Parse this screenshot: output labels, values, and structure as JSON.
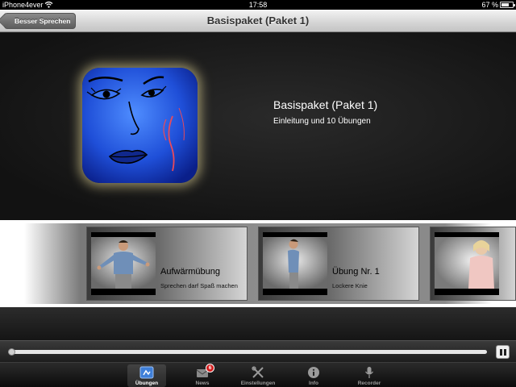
{
  "status_bar": {
    "carrier": "iPhone4ever",
    "time": "17:58",
    "battery_percent": "67 %",
    "battery_level": 0.67
  },
  "nav_bar": {
    "back_label": "Besser Sprechen",
    "title": "Basispaket (Paket 1)"
  },
  "package": {
    "title": "Basispaket (Paket 1)",
    "subtitle": "Einleitung und 10 Übungen",
    "icon_name": "face-sketch-app-icon"
  },
  "exercises": [
    {
      "title": "Aufwärmübung",
      "subtitle": "Sprechen darf Spaß machen",
      "thumb_icon": "man-stretching-thumbnail"
    },
    {
      "title": "Übung Nr. 1",
      "subtitle": "Lockere Knie",
      "thumb_icon": "man-standing-profile-thumbnail"
    },
    {
      "title": "",
      "subtitle": "",
      "thumb_icon": "woman-portrait-thumbnail"
    }
  ],
  "player": {
    "progress": 0.0
  },
  "tab_bar": {
    "tabs": [
      {
        "label": "Übungen",
        "icon": "exercises-icon",
        "active": true
      },
      {
        "label": "News",
        "icon": "news-icon",
        "badge": "6"
      },
      {
        "label": "Einstellungen",
        "icon": "tools-icon"
      },
      {
        "label": "Info",
        "icon": "info-icon"
      },
      {
        "label": "Recorder",
        "icon": "microphone-icon"
      }
    ]
  }
}
